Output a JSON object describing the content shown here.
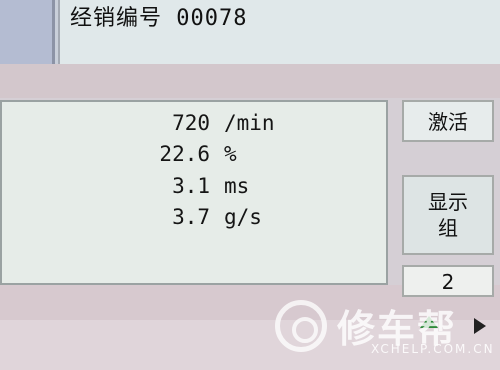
{
  "header": {
    "dealer_label": "经销编号",
    "dealer_number": "00078"
  },
  "readings": [
    {
      "value": "720",
      "unit": "/min"
    },
    {
      "value": "22.6",
      "unit": "%"
    },
    {
      "value": "3.1",
      "unit": "ms"
    },
    {
      "value": "3.7",
      "unit": "g/s"
    }
  ],
  "side_panel": {
    "activate_label": "激活",
    "display_group_line1": "显示",
    "display_group_line2": "组",
    "group_number": "2"
  },
  "watermark": {
    "brand": "修车帮",
    "domain": "XCHELP.COM.CN"
  },
  "colors": {
    "panel_bg": "#e6ece8",
    "page_bg": "#d5cfd5",
    "arrow_green": "#2f8a3a"
  }
}
